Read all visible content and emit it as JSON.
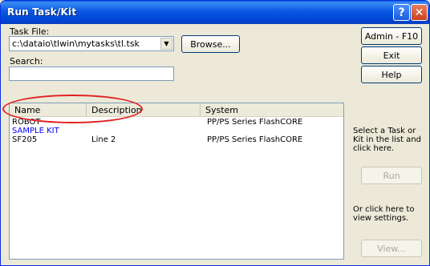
{
  "window": {
    "title": "Run Task/Kit"
  },
  "task_file": {
    "label": "Task File:",
    "value": "c:\\dataio\\tlwin\\mytasks\\tl.tsk",
    "browse_label": "Browse..."
  },
  "search": {
    "label": "Search:",
    "value": ""
  },
  "buttons": {
    "admin": "Admin - F10",
    "exit": "Exit",
    "help": "Help",
    "run": "Run",
    "view": "View..."
  },
  "list": {
    "columns": [
      "Name",
      "Description",
      "System"
    ],
    "rows": [
      {
        "name": "ROBOT",
        "description": "",
        "system": "PP/PS Series FlashCORE",
        "color": "#000000"
      },
      {
        "name": "SAMPLE KIT",
        "description": "",
        "system": "",
        "color": "#0000ff"
      },
      {
        "name": "SF205",
        "description": "Line 2",
        "system": "PP/PS Series FlashCORE",
        "color": "#000000"
      }
    ]
  },
  "side": {
    "select_hint": "Select a Task or Kit in the list and click here.",
    "view_hint": "Or click here to view settings."
  },
  "colors": {
    "title_bar": "#0054e3",
    "annotation_ellipse": "#e02020",
    "kit_text": "#0000ff"
  }
}
